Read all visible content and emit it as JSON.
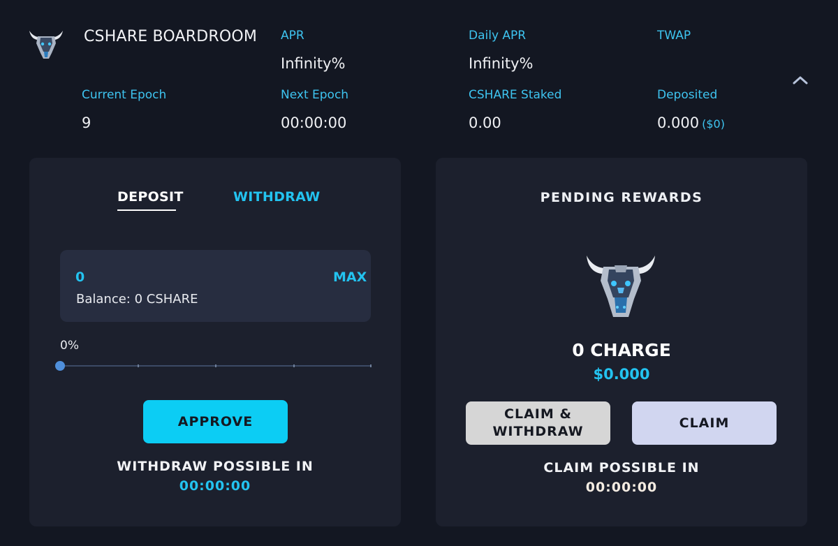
{
  "header": {
    "title": "CSHARE BOARDROOM",
    "stats": {
      "apr": {
        "label": "APR",
        "value": "Infinity%"
      },
      "daily_apr": {
        "label": "Daily APR",
        "value": "Infinity%"
      },
      "twap": {
        "label": "TWAP",
        "value": ""
      },
      "current_epoch": {
        "label": "Current Epoch",
        "value": "9"
      },
      "next_epoch": {
        "label": "Next Epoch",
        "value": "00:00:00"
      },
      "staked": {
        "label": "CSHARE Staked",
        "value": "0.00"
      },
      "deposited": {
        "label": "Deposited",
        "value": "0.000",
        "usd": "($0)"
      }
    }
  },
  "stake_panel": {
    "tabs": [
      "DEPOSIT",
      "WITHDRAW"
    ],
    "active_tab": "DEPOSIT",
    "amount": "0",
    "max_label": "MAX",
    "balance": "Balance: 0 CSHARE",
    "percent_label": "0%",
    "percent_value": 0,
    "approve_label": "APPROVE",
    "withdraw_possible_label": "WITHDRAW POSSIBLE IN",
    "withdraw_timer": "00:00:00"
  },
  "rewards_panel": {
    "title": "PENDING REWARDS",
    "amount": "0 CHARGE",
    "usd": "$0.000",
    "claim_withdraw_label": "CLAIM & WITHDRAW",
    "claim_label": "CLAIM",
    "claim_possible_label": "CLAIM POSSIBLE IN",
    "claim_timer": "00:00:00"
  },
  "icons": {
    "logo": "bull-head-icon",
    "collapse": "chevron-up-icon"
  },
  "colors": {
    "background": "#131722",
    "card": "#1c202d",
    "accent": "#23c3f0",
    "approve": "#0ccdf4",
    "claim_withdraw": "#d6d6d6",
    "claim": "#d1d6f0"
  }
}
